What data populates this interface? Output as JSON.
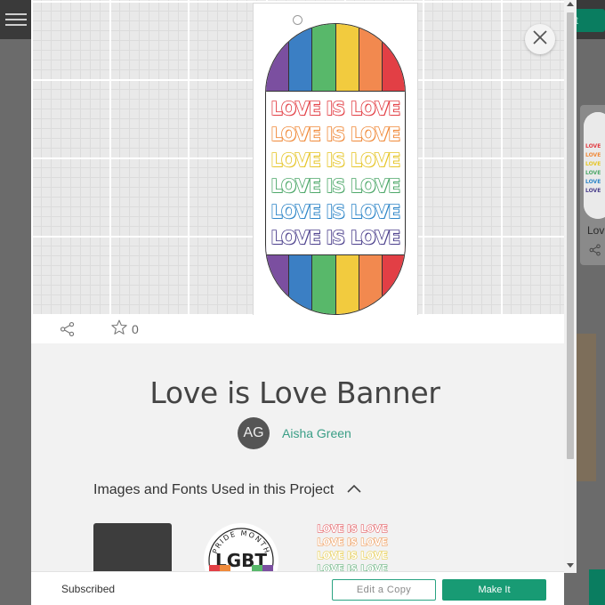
{
  "background": {
    "menu_icon": "hamburger-icon",
    "green_button_label": "ect",
    "card_title": "Lov",
    "share_icon": "share-icon"
  },
  "modal": {
    "close_icon": "close-icon",
    "canvas": {
      "banner_lines": [
        "LOVE IS LOVE",
        "LOVE IS LOVE",
        "LOVE IS LOVE",
        "LOVE IS LOVE",
        "LOVE IS LOVE",
        "LOVE IS LOVE"
      ],
      "stripe_colors": [
        "#7b4fa0",
        "#3b7fc4",
        "#58b86a",
        "#f2cb3e",
        "#f2894f",
        "#e23f45"
      ],
      "line_colors": [
        "#e23f45",
        "#f08a3a",
        "#e6c62a",
        "#4ea86a",
        "#2e86c8",
        "#4b3f8c"
      ]
    },
    "actions": {
      "share_icon": "share-icon",
      "star_icon": "star-icon",
      "favorite_count": "0"
    },
    "project": {
      "title": "Love is Love Banner",
      "author_initials": "AG",
      "author_name": "Aisha Green",
      "section_title": "Images and Fonts Used in this Project",
      "section_toggle_icon": "chevron-up-icon",
      "thumbnails": {
        "badge_top_text": "PRIDE MONTH",
        "badge_main_text": "LGBT",
        "mini_lines": [
          "LOVE IS LOVE",
          "LOVE IS LOVE",
          "LOVE IS LOVE",
          "LOVE IS LOVE"
        ]
      }
    },
    "footer": {
      "status": "Subscribed",
      "edit_copy_label": "Edit a Copy",
      "make_it_label": "Make It"
    }
  }
}
